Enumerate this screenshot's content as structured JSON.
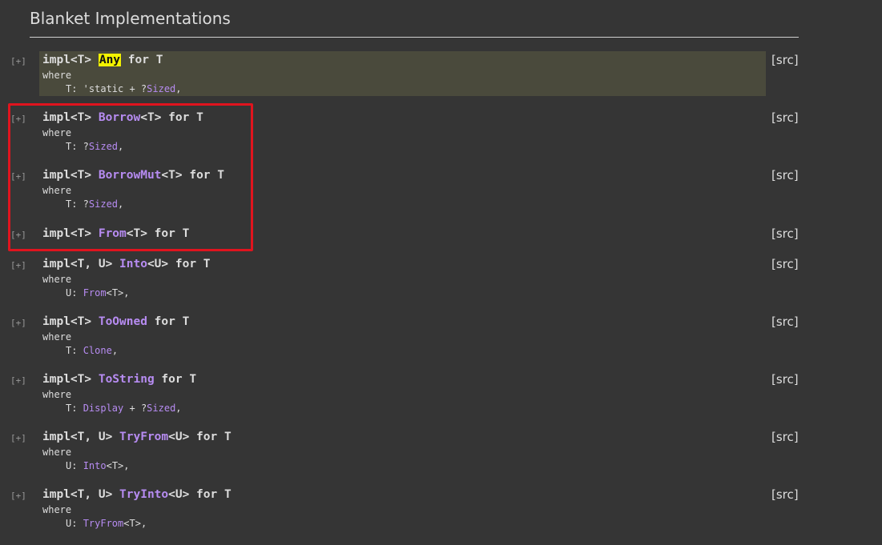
{
  "section": {
    "title": "Blanket Implementations"
  },
  "toggle_label": "[+]",
  "src_label": "[src]",
  "where_label": "where",
  "impls": [
    {
      "prefix": "impl<T> ",
      "trait": "Any",
      "suffix": " for T",
      "bound_prefix": "T: 'static + ?",
      "bound_trait": "Sized",
      "bound_suffix": ",",
      "highlighted": true
    },
    {
      "prefix": "impl<T> ",
      "trait": "Borrow",
      "suffix": "<T> for T",
      "bound_prefix": "T: ?",
      "bound_trait": "Sized",
      "bound_suffix": ","
    },
    {
      "prefix": "impl<T> ",
      "trait": "BorrowMut",
      "suffix": "<T> for T",
      "bound_prefix": "T: ?",
      "bound_trait": "Sized",
      "bound_suffix": ","
    },
    {
      "prefix": "impl<T> ",
      "trait": "From",
      "suffix": "<T> for T"
    },
    {
      "prefix": "impl<T, U> ",
      "trait": "Into",
      "suffix": "<U> for T",
      "bound_prefix": "U: ",
      "bound_trait": "From",
      "bound_suffix": "<T>,"
    },
    {
      "prefix": "impl<T> ",
      "trait": "ToOwned",
      "suffix": " for T",
      "bound_prefix": "T: ",
      "bound_trait": "Clone",
      "bound_suffix": ","
    },
    {
      "prefix": "impl<T> ",
      "trait": "ToString",
      "suffix": " for T",
      "bound_prefix": "T: ",
      "bound_trait": "Display",
      "bound_mid": " + ?",
      "bound_trait2": "Sized",
      "bound_suffix": ","
    },
    {
      "prefix": "impl<T, U> ",
      "trait": "TryFrom",
      "suffix": "<U> for T",
      "bound_prefix": "U: ",
      "bound_trait": "Into",
      "bound_suffix": "<T>,"
    },
    {
      "prefix": "impl<T, U> ",
      "trait": "TryInto",
      "suffix": "<U> for T",
      "bound_prefix": "U: ",
      "bound_trait": "TryFrom",
      "bound_suffix": "<T>,"
    }
  ],
  "colors": {
    "background": "#353535",
    "text": "#dddddd",
    "trait": "#b78cf2",
    "search_highlight": "#f2f200",
    "annotation_box": "#e0141e"
  }
}
